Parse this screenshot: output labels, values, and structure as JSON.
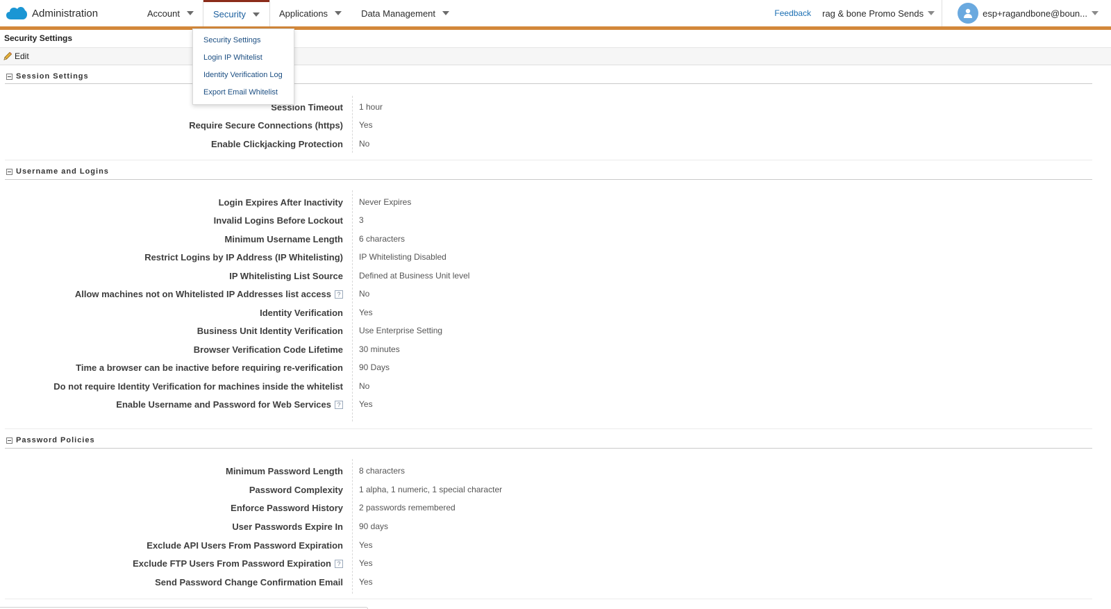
{
  "header": {
    "app_title": "Administration",
    "menu": [
      {
        "label": "Account"
      },
      {
        "label": "Security"
      },
      {
        "label": "Applications"
      },
      {
        "label": "Data Management"
      }
    ],
    "feedback_label": "Feedback",
    "business_unit": "rag & bone Promo Sends",
    "user_name": "esp+ragandbone@boun...",
    "colors": {
      "accent_bar": "#d3883a",
      "active_tab_top": "#8b2c1a",
      "link": "#1b6fb3"
    }
  },
  "dropdown": {
    "items": [
      {
        "label": "Security Settings"
      },
      {
        "label": "Login IP Whitelist"
      },
      {
        "label": "Identity Verification Log"
      },
      {
        "label": "Export Email Whitelist"
      }
    ]
  },
  "page": {
    "title": "Security Settings",
    "edit_label": "Edit"
  },
  "sections": {
    "session": {
      "title": "Session Settings",
      "rows": [
        {
          "label": "Session Timeout",
          "value": "1 hour"
        },
        {
          "label": "Require Secure Connections (https)",
          "value": "Yes"
        },
        {
          "label": "Enable Clickjacking Protection",
          "value": "No"
        }
      ]
    },
    "logins": {
      "title": "Username and Logins",
      "rows": [
        {
          "label": "Login Expires After Inactivity",
          "value": "Never Expires"
        },
        {
          "label": "Invalid Logins Before Lockout",
          "value": "3"
        },
        {
          "label": "Minimum Username Length",
          "value": "6 characters"
        },
        {
          "label": "Restrict Logins by IP Address (IP Whitelisting)",
          "value": "IP Whitelisting Disabled"
        },
        {
          "label": "IP Whitelisting List Source",
          "value": "Defined at Business Unit level"
        },
        {
          "label": "Allow machines not on Whitelisted IP Addresses list access",
          "value": "No"
        },
        {
          "label": "Identity Verification",
          "value": "Yes"
        },
        {
          "label": "Business Unit Identity Verification",
          "value": "Use Enterprise Setting"
        },
        {
          "label": "Browser Verification Code Lifetime",
          "value": "30 minutes"
        },
        {
          "label": "Time a browser can be inactive before requiring re-verification",
          "value": "90 Days"
        },
        {
          "label": "Do not require Identity Verification for machines inside the whitelist",
          "value": "No"
        },
        {
          "label": "Enable Username and Password for Web Services",
          "value": "Yes"
        }
      ]
    },
    "password": {
      "title": "Password Policies",
      "rows": [
        {
          "label": "Minimum Password Length",
          "value": "8 characters"
        },
        {
          "label": "Password Complexity",
          "value": "1 alpha, 1 numeric, 1 special character"
        },
        {
          "label": "Enforce Password History",
          "value": "2 passwords remembered"
        },
        {
          "label": "User Passwords Expire In",
          "value": "90 days"
        },
        {
          "label": "Exclude API Users From Password Expiration",
          "value": "Yes"
        },
        {
          "label": "Exclude FTP Users From Password Expiration",
          "value": "Yes"
        },
        {
          "label": "Send Password Change Confirmation Email",
          "value": "Yes"
        }
      ]
    }
  },
  "help_glyph": "?"
}
